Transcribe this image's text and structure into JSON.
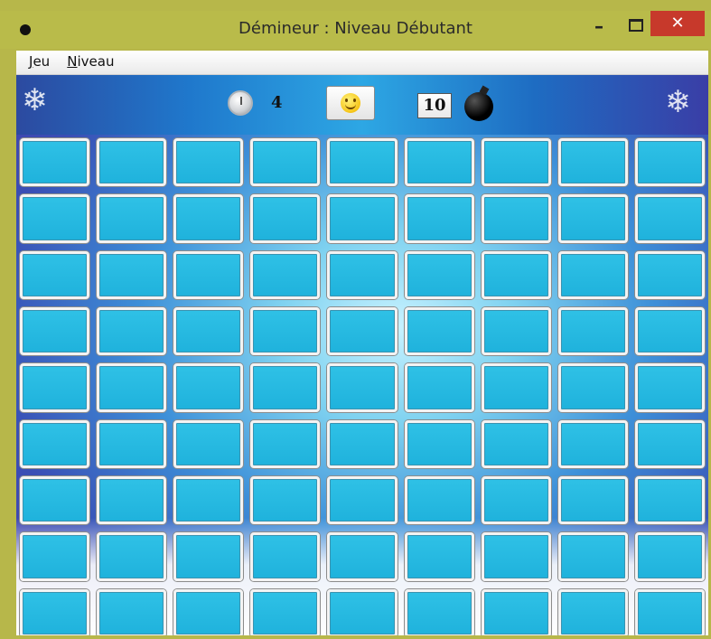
{
  "window": {
    "title": "Démineur : Niveau Débutant",
    "minimize_label": "–",
    "close_label": "✕"
  },
  "menu": {
    "items": [
      {
        "label": "Jeu",
        "accel": "J",
        "rest": "eu"
      },
      {
        "label": "Niveau",
        "accel": "N",
        "rest": "iveau"
      }
    ]
  },
  "status": {
    "time": "4",
    "mines_remaining": "10",
    "face": "smiley"
  },
  "board": {
    "rows": 9,
    "cols": 9,
    "cell_state": "covered"
  },
  "colors": {
    "titlebar": "#b9bb4a",
    "close_button": "#c7392b",
    "cell": "#2fc1e6"
  },
  "icons": [
    "app-icon",
    "stopwatch-icon",
    "smiley-icon",
    "bomb-icon"
  ]
}
